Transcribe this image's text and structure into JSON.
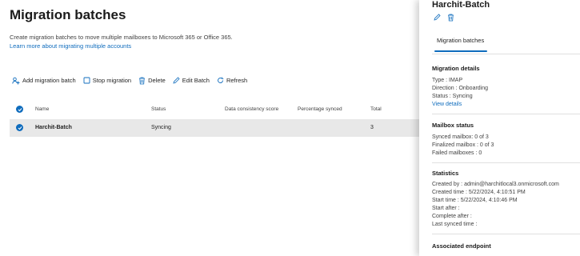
{
  "page": {
    "title": "Migration batches",
    "description": "Create migration batches to move multiple mailboxes to Microsoft 365 or Office 365.",
    "learn_more": "Learn more about migrating multiple accounts"
  },
  "toolbar": {
    "add": "Add migration batch",
    "stop": "Stop migration",
    "delete": "Delete",
    "edit": "Edit Batch",
    "refresh": "Refresh"
  },
  "table": {
    "columns": [
      "Name",
      "Status",
      "Data consistency score",
      "Percentage synced",
      "Total"
    ],
    "rows": [
      {
        "name": "Harchit-Batch",
        "status": "Syncing",
        "consistency": "",
        "percentage": "",
        "total": "3"
      }
    ]
  },
  "panel": {
    "title": "Harchit-Batch",
    "tab": "Migration batches",
    "details": {
      "title": "Migration details",
      "type": "Type : IMAP",
      "direction": "Direction : Onboarding",
      "status": "Status : Syncing",
      "view_details": "View details"
    },
    "mailbox": {
      "title": "Mailbox status",
      "synced": "Synced mailbox: 0 of 3",
      "finalized": "Finalized mailbox : 0 of 3",
      "failed": "Failed mailboxes : 0"
    },
    "statistics": {
      "title": "Statistics",
      "created_by": "Created by : admin@harchitlocal3.onmicrosoft.com",
      "created_time": "Created time : 5/22/2024, 4:10:51 PM",
      "start_time": "Start time : 5/22/2024, 4:10:46 PM",
      "start_after": "Start after :",
      "complete_after": "Complete after :",
      "last_synced": "Last synced time :"
    },
    "endpoint": {
      "title": "Associated endpoint"
    }
  },
  "colors": {
    "accent": "#0f6cbd",
    "selected_row": "#e8e8e8"
  }
}
